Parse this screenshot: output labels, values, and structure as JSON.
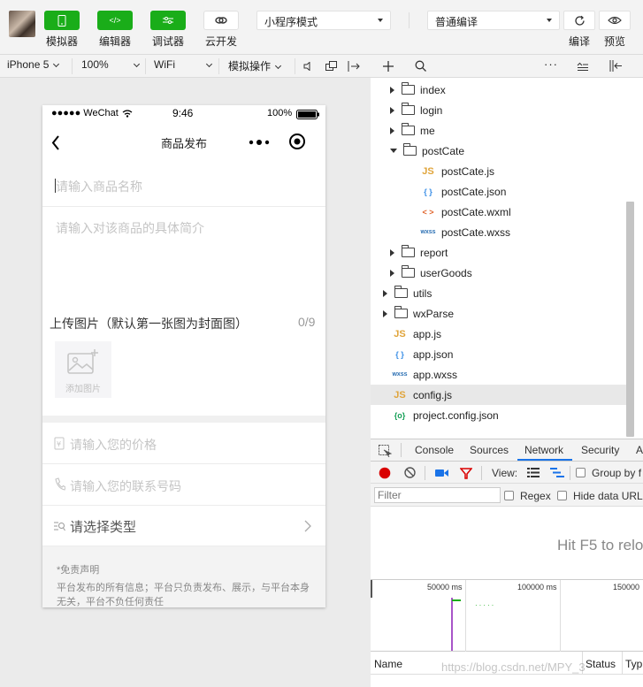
{
  "toolbar": {
    "simulator_label": "模拟器",
    "editor_label": "编辑器",
    "debugger_label": "调试器",
    "cloud_label": "云开发",
    "mode_select": "小程序模式",
    "compile_select": "普通编译",
    "compile_label": "编译",
    "preview_label": "预览"
  },
  "devicebar": {
    "device": "iPhone 5",
    "zoom": "100%",
    "network": "WiFi",
    "simulate": "模拟操作"
  },
  "phone": {
    "carrier": "●●●●● WeChat",
    "time": "9:46",
    "battery": "100%",
    "title": "商品发布",
    "name_placeholder": "请输入商品名称",
    "desc_placeholder": "请输入对该商品的具体简介",
    "upload_title": "上传图片（默认第一张图为封面图）",
    "upload_count": "0/9",
    "add_image": "添加图片",
    "price_placeholder": "请输入您的价格",
    "phone_placeholder": "请输入您的联系号码",
    "type_select": "请选择类型",
    "disclaimer_title": "*免责声明",
    "disclaimer_text": "平台发布的所有信息；平台只负责发布、展示，与平台本身无关，平台不负任何责任"
  },
  "tree": [
    {
      "name": "index",
      "kind": "folder",
      "indent": 1,
      "open": false
    },
    {
      "name": "login",
      "kind": "folder",
      "indent": 1,
      "open": false
    },
    {
      "name": "me",
      "kind": "folder",
      "indent": 1,
      "open": false
    },
    {
      "name": "postCate",
      "kind": "folder",
      "indent": 1,
      "open": true
    },
    {
      "name": "postCate.js",
      "kind": "js",
      "indent": 2
    },
    {
      "name": "postCate.json",
      "kind": "json",
      "indent": 2
    },
    {
      "name": "postCate.wxml",
      "kind": "wxml",
      "indent": 2
    },
    {
      "name": "postCate.wxss",
      "kind": "wxss",
      "indent": 2
    },
    {
      "name": "report",
      "kind": "folder",
      "indent": 1,
      "open": false
    },
    {
      "name": "userGoods",
      "kind": "folder",
      "indent": 1,
      "open": false
    },
    {
      "name": "utils",
      "kind": "folder",
      "indent": 0,
      "open": false
    },
    {
      "name": "wxParse",
      "kind": "folder",
      "indent": 0,
      "open": false
    },
    {
      "name": "app.js",
      "kind": "js",
      "indent": 0
    },
    {
      "name": "app.json",
      "kind": "json",
      "indent": 0
    },
    {
      "name": "app.wxss",
      "kind": "wxss",
      "indent": 0
    },
    {
      "name": "config.js",
      "kind": "js",
      "indent": 0,
      "selected": true
    },
    {
      "name": "project.config.json",
      "kind": "pjson",
      "indent": 0
    }
  ],
  "devtools": {
    "tabs": [
      "Console",
      "Sources",
      "Network",
      "Security",
      "A"
    ],
    "active_tab": "Network",
    "view_label": "View:",
    "group_label": "Group by f",
    "filter_placeholder": "Filter",
    "regex_label": "Regex",
    "hide_data_label": "Hide data URLs",
    "hint": "Hit F5 to relo",
    "timeline": [
      "50000 ms",
      "100000 ms",
      "150000"
    ],
    "col_name": "Name",
    "col_status": "Status",
    "col_type": "Typ",
    "watermark": "https://blog.csdn.net/MPY_3"
  }
}
